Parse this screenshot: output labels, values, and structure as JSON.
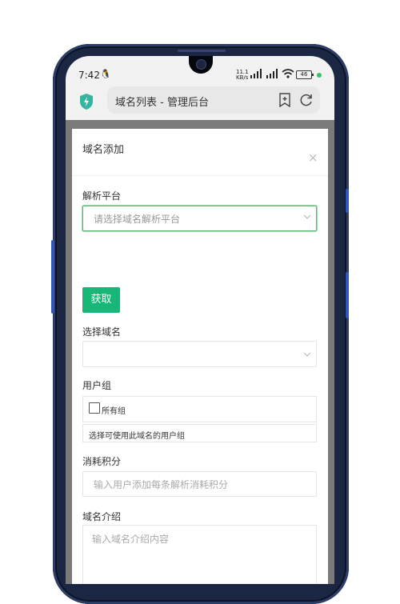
{
  "status_bar": {
    "time": "7:42",
    "notification_icon": "qq-penguin-icon",
    "net_speed": "11.1",
    "net_unit": "KB/s",
    "battery": "46",
    "colors": {
      "dot": "#33c46a"
    }
  },
  "browser": {
    "url_title": "域名列表 - 管理后台",
    "icons": [
      "shield-icon",
      "bookmark-icon",
      "reload-icon"
    ]
  },
  "modal": {
    "title": "域名添加",
    "close": "×",
    "fields": {
      "platform_label": "解析平台",
      "platform_placeholder": "请选择域名解析平台",
      "fetch_button": "获取",
      "domain_label": "选择域名",
      "domain_value": "",
      "group_label": "用户组",
      "group_all": "所有组",
      "group_hint": "选择可使用此域名的用户组",
      "points_label": "消耗积分",
      "points_placeholder": "输入用户添加每条解析消耗积分",
      "intro_label": "域名介绍",
      "intro_placeholder": "输入域名介绍内容"
    },
    "colors": {
      "primary": "#16b777",
      "focus": "#5fb878"
    }
  }
}
